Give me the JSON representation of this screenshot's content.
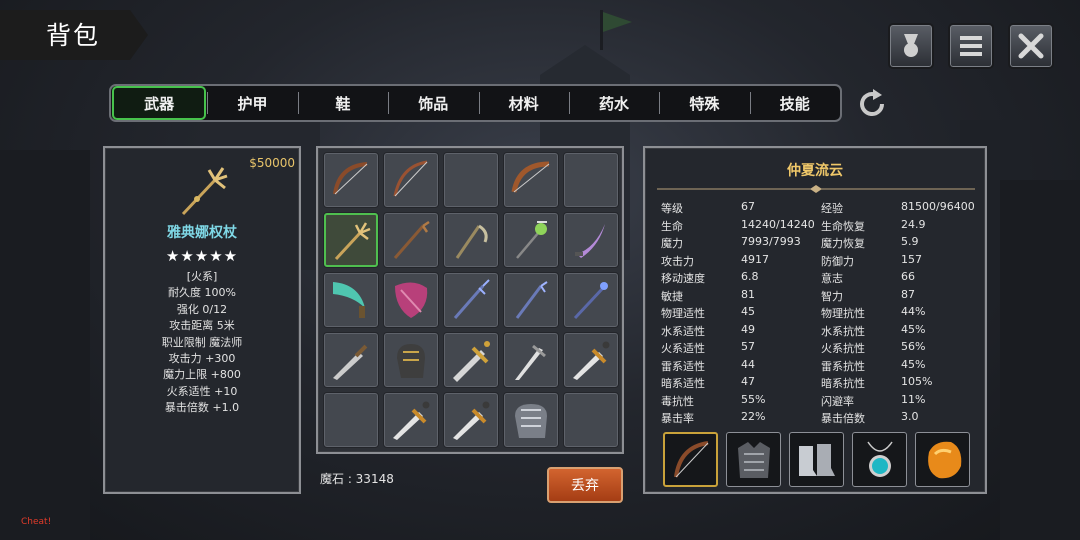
{
  "header": {
    "title": "背包"
  },
  "tabs": [
    {
      "label": "武器",
      "active": true
    },
    {
      "label": "护甲",
      "active": false
    },
    {
      "label": "鞋",
      "active": false
    },
    {
      "label": "饰品",
      "active": false
    },
    {
      "label": "材料",
      "active": false
    },
    {
      "label": "药水",
      "active": false
    },
    {
      "label": "特殊",
      "active": false
    },
    {
      "label": "技能",
      "active": false
    }
  ],
  "item_detail": {
    "price": "$50000",
    "name": "雅典娜权杖",
    "stars": "★★★★★",
    "element": "[火系]",
    "lines": [
      "耐久度 100%",
      "强化 0/12",
      "攻击距离  5米",
      "职业限制  魔法师",
      "攻击力  +300",
      "魔力上限  +800",
      "火系适性  +10",
      "暴击倍数  +1.0"
    ]
  },
  "inventory": {
    "slots": [
      "bow",
      "bow",
      "",
      "bow",
      "",
      "scepter",
      "staff",
      "scythe",
      "staff-green",
      "blade-purple",
      "blade-teal",
      "shield-pink",
      "staff-blue",
      "staff-blue",
      "staff-blue",
      "sword",
      "gauntlet",
      "sword-gold",
      "sword-silver",
      "sword",
      "",
      "sword",
      "sword",
      "gauntlet-steel",
      ""
    ],
    "selected_index": 5,
    "currency_label": "魔石 : 33148",
    "discard_label": "丢弃"
  },
  "character": {
    "name": "仲夏流云",
    "stats": [
      [
        "等级",
        "67",
        "经验",
        "81500/96400"
      ],
      [
        "生命",
        "14240/14240",
        "生命恢复",
        "24.9"
      ],
      [
        "魔力",
        "7993/7993",
        "魔力恢复",
        "5.9"
      ],
      [
        "攻击力",
        "4917",
        "防御力",
        "157"
      ],
      [
        "移动速度",
        "6.8",
        "意志",
        "66"
      ],
      [
        "敏捷",
        "81",
        "智力",
        "87"
      ],
      [
        "物理适性",
        "45",
        "物理抗性",
        "44%"
      ],
      [
        "水系适性",
        "49",
        "水系抗性",
        "45%"
      ],
      [
        "火系适性",
        "57",
        "火系抗性",
        "56%"
      ],
      [
        "雷系适性",
        "44",
        "雷系抗性",
        "45%"
      ],
      [
        "暗系适性",
        "47",
        "暗系抗性",
        "105%"
      ],
      [
        "毒抗性",
        "55%",
        "闪避率",
        "11%"
      ],
      [
        "暴击率",
        "22%",
        "暴击倍数",
        "3.0"
      ]
    ],
    "equipment": [
      "bow-icon",
      "chest-armor-icon",
      "boots-icon",
      "amulet-icon",
      "amber-gem-icon"
    ]
  },
  "debug_label": "Cheat!",
  "colors": {
    "accent_green": "#47c24c",
    "gold": "#f0c869",
    "discard": "#c04d1f"
  }
}
